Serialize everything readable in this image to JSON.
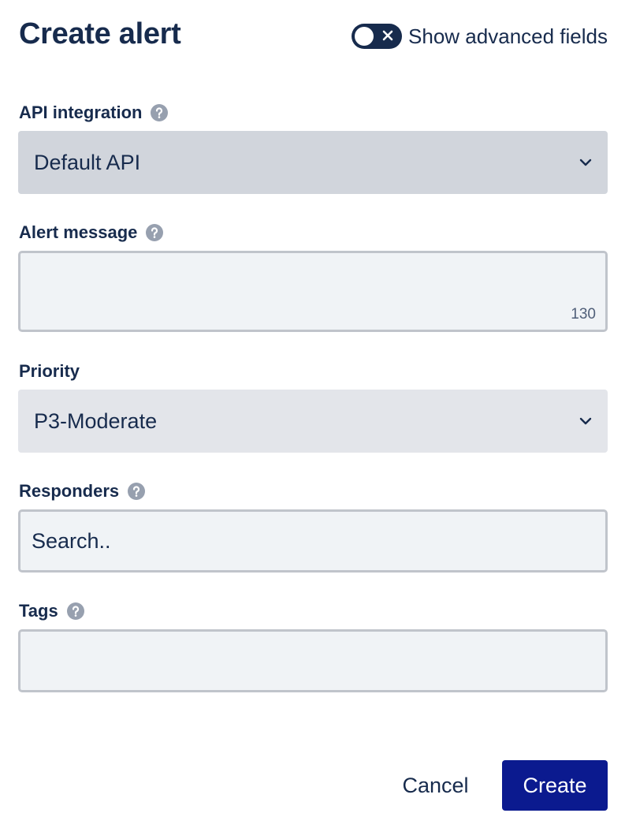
{
  "header": {
    "title": "Create alert",
    "advanced_toggle": {
      "label": "Show advanced fields",
      "checked": false
    }
  },
  "form": {
    "api_integration": {
      "label": "API integration",
      "value": "Default API",
      "icon": "help-icon"
    },
    "alert_message": {
      "label": "Alert message",
      "value": "",
      "remaining": "130",
      "icon": "help-icon"
    },
    "priority": {
      "label": "Priority",
      "value": "P3-Moderate"
    },
    "responders": {
      "label": "Responders",
      "placeholder": "Search..",
      "icon": "help-icon"
    },
    "tags": {
      "label": "Tags",
      "value": "",
      "icon": "help-icon"
    }
  },
  "footer": {
    "cancel_label": "Cancel",
    "create_label": "Create"
  },
  "colors": {
    "primary_button": "#0b1a8f",
    "text": "#172b4d",
    "toggle_off": "#172b4d"
  }
}
